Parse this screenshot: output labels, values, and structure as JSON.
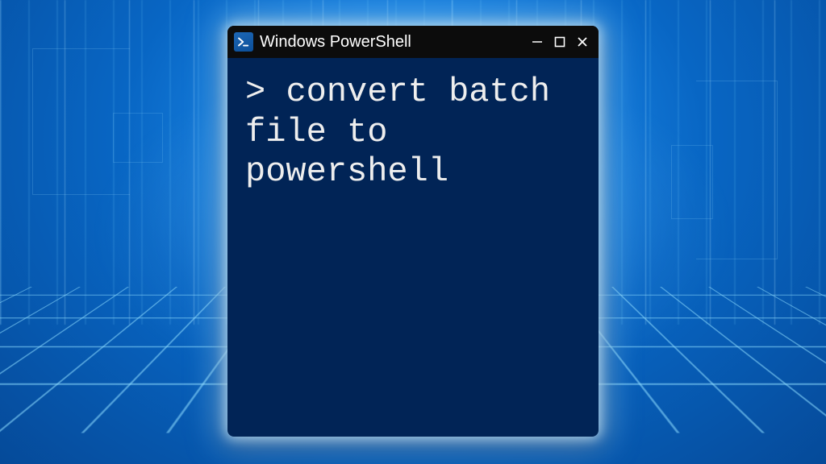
{
  "window": {
    "title": "Windows PowerShell"
  },
  "terminal": {
    "prompt": ">",
    "command": "convert batch file to powershell"
  },
  "colors": {
    "terminal_bg": "#012456",
    "titlebar_bg": "#0c0c0c",
    "text": "#eeeeee"
  }
}
